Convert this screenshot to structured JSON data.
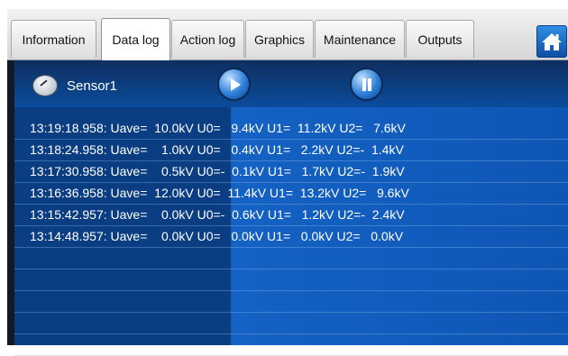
{
  "tabs": [
    {
      "label": "Information",
      "active": false
    },
    {
      "label": "Data log",
      "active": true
    },
    {
      "label": "Action log",
      "active": false
    },
    {
      "label": "Graphics",
      "active": false
    },
    {
      "label": "Maintenance",
      "active": false
    },
    {
      "label": "Outputs",
      "active": false
    }
  ],
  "home_icon": "home-icon",
  "toolbar": {
    "sensor_label": "Sensor1",
    "sensor_icon": "gauge-icon",
    "play_icon": "play-icon",
    "pause_icon": "pause-icon"
  },
  "log_rows": [
    "13:19:18.958: Uave=  10.0kV U0=   9.4kV U1=  11.2kV U2=   7.6kV",
    "13:18:24.958: Uave=    1.0kV U0=   0.4kV U1=   2.2kV U2=-  1.4kV",
    "13:17:30.958: Uave=    0.5kV U0=-  0.1kV U1=   1.7kV U2=-  1.9kV",
    "13:16:36.958: Uave=  12.0kV U0=  11.4kV U1=  13.2kV U2=   9.6kV",
    "13:15:42.957: Uave=    0.0kV U0=-  0.6kV U1=   1.2kV U2=-  2.4kV",
    "13:14:48.957: Uave=    0.0kV U0=   0.0kV U1=   0.0kV U2=   0.0kV",
    "",
    "",
    "",
    "",
    ""
  ],
  "colors": {
    "tab_active": "#ffffff",
    "panel_left": "#0a3d82",
    "panel_right": "#1462c4",
    "text": "#ffffff"
  }
}
